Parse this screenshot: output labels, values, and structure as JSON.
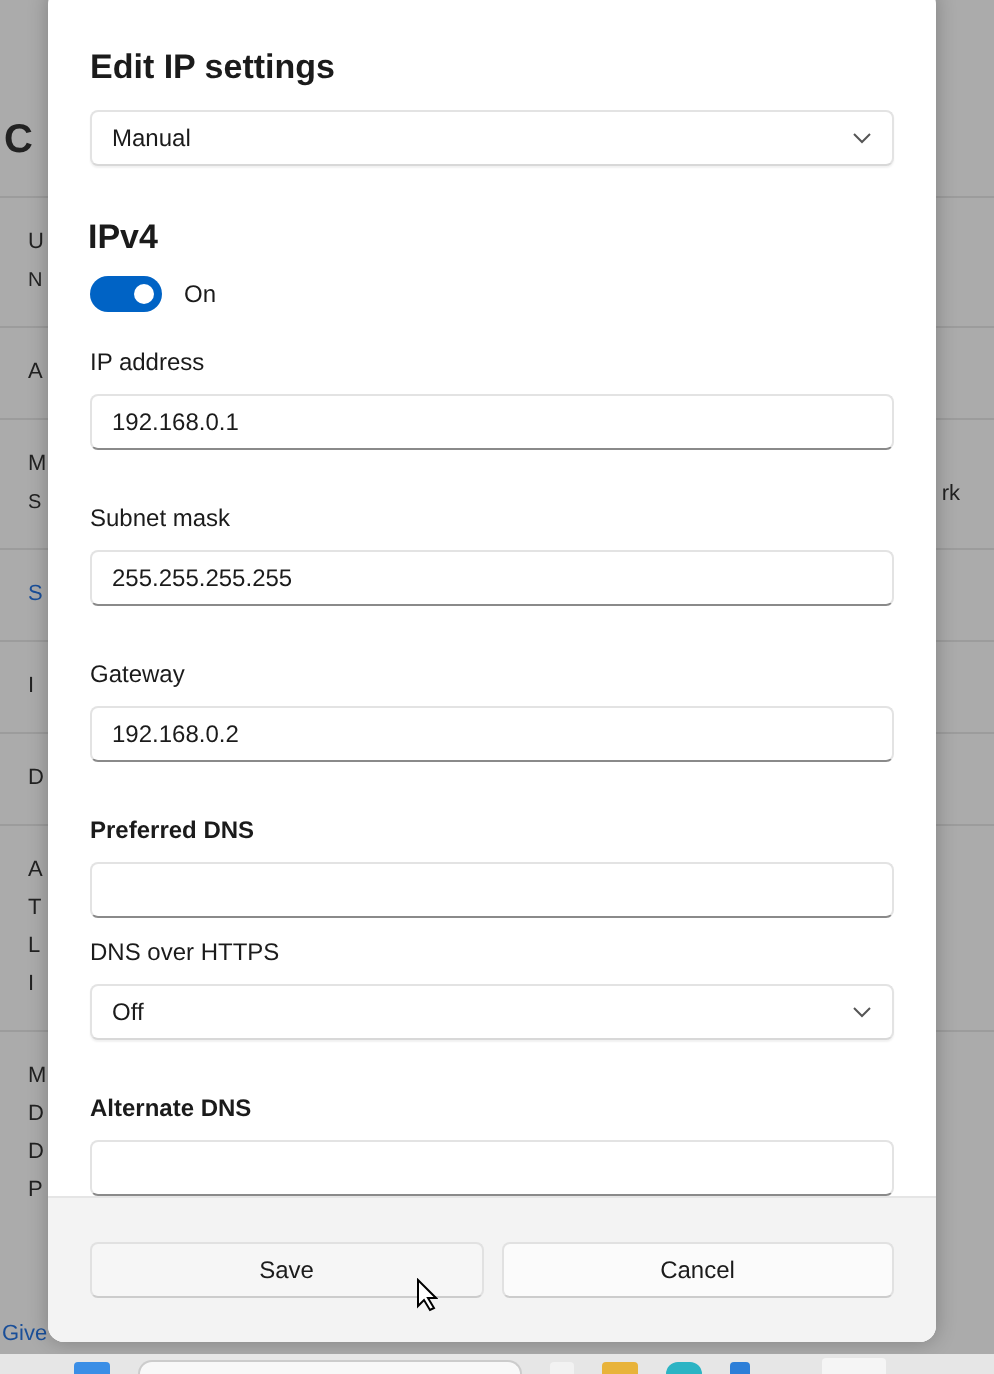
{
  "background": {
    "heading": "C",
    "rows": [
      {
        "kind": "item",
        "lines": [
          "U",
          "N"
        ]
      },
      {
        "kind": "item",
        "lines": [
          "A"
        ]
      },
      {
        "kind": "item",
        "lines": [
          "M",
          "S"
        ],
        "aside": "rk"
      },
      {
        "kind": "link",
        "lines": [
          "S"
        ]
      },
      {
        "kind": "item",
        "lines": [
          "I"
        ]
      },
      {
        "kind": "item",
        "lines": [
          "D"
        ]
      },
      {
        "kind": "item",
        "lines": [
          "A",
          "T",
          "L",
          "I"
        ]
      },
      {
        "kind": "item",
        "lines": [
          "M",
          "D",
          "D",
          "P"
        ]
      },
      {
        "kind": "link",
        "lines": [
          "Give"
        ]
      }
    ]
  },
  "dialog": {
    "title": "Edit IP settings",
    "mode": "Manual",
    "section": {
      "title": "IPv4",
      "on": true,
      "state_label": "On"
    },
    "fields": [
      {
        "kind": "text",
        "label": "IP address",
        "bold": false,
        "value": "192.168.0.1"
      },
      {
        "kind": "text",
        "label": "Subnet mask",
        "bold": false,
        "value": "255.255.255.255"
      },
      {
        "kind": "text",
        "label": "Gateway",
        "bold": false,
        "value": "192.168.0.2"
      },
      {
        "kind": "text",
        "label": "Preferred DNS",
        "bold": true
      },
      {
        "kind": "dropdown",
        "label": "DNS over HTTPS",
        "bold": false,
        "value": "Off"
      },
      {
        "kind": "text",
        "label": "Alternate DNS",
        "bold": true
      }
    ],
    "buttons": [
      "Save",
      "Cancel"
    ]
  }
}
